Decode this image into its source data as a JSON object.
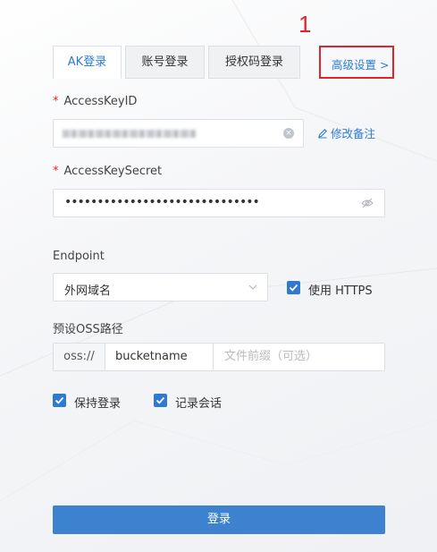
{
  "annotation": {
    "number": "1"
  },
  "tabs": [
    {
      "label": "AK登录",
      "active": true
    },
    {
      "label": "账号登录",
      "active": false
    },
    {
      "label": "授权码登录",
      "active": false
    }
  ],
  "advanced_link": "高级设置 >",
  "access_key_id": {
    "required_mark": "*",
    "label": "AccessKeyID",
    "edit_note": "修改备注"
  },
  "access_key_secret": {
    "required_mark": "*",
    "label": "AccessKeySecret",
    "masked_value": "••••••••••••••••••••••••••••••"
  },
  "endpoint": {
    "label": "Endpoint",
    "selected": "外网域名",
    "https_label": "使用 HTTPS",
    "https_checked": true
  },
  "oss_path": {
    "label": "预设OSS路径",
    "prefix": "oss://",
    "bucket": "bucketname",
    "file_prefix_placeholder": "文件前缀（可选）"
  },
  "options": {
    "keep_login": "保持登录",
    "keep_login_checked": true,
    "record_session": "记录会话",
    "record_session_checked": true
  },
  "login_button": "登录",
  "colors": {
    "accent": "#2c7bd6",
    "button": "#3c82cf",
    "annotation": "#e0242d"
  },
  "icons": [
    "clear-icon",
    "edit-icon",
    "eye-off-icon",
    "chevron-down-icon",
    "check-icon"
  ]
}
